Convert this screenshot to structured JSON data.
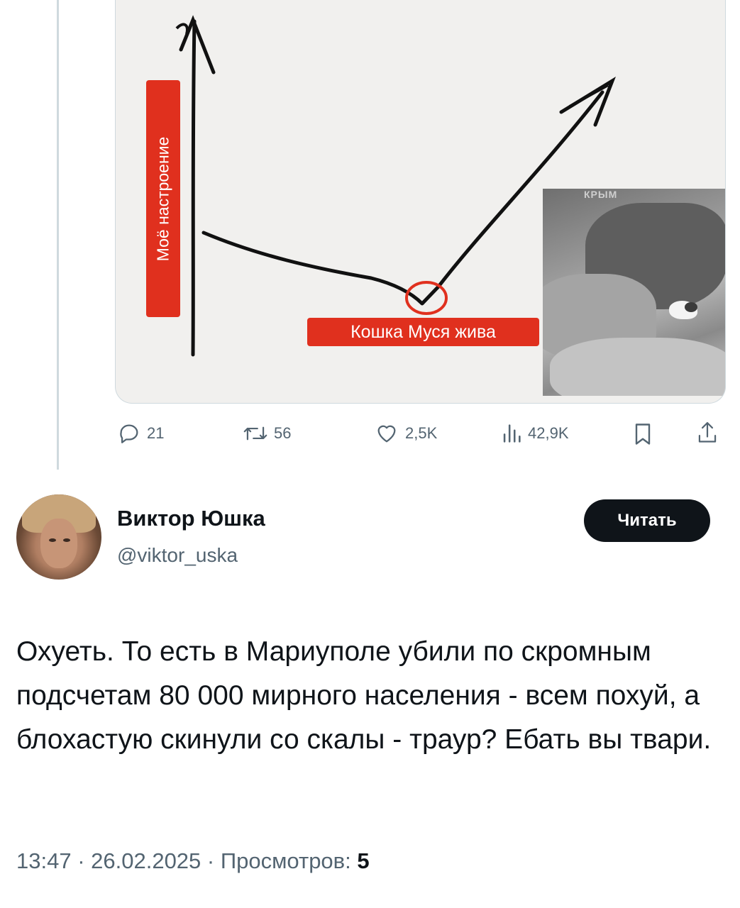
{
  "quoted_tweet": {
    "media": {
      "meme_vertical_label": "Моё настроение",
      "meme_horizontal_label": "Кошка Муся жива",
      "photo_watermark": "КРЫМ"
    },
    "actions": {
      "replies": "21",
      "reposts": "56",
      "likes": "2,5K",
      "views": "42,9K"
    }
  },
  "tweet": {
    "author_name": "Виктор Юшка",
    "author_handle": "@viktor_uska",
    "follow_label": "Читать",
    "text": "Охуеть. То есть в Мариуполе убили по скромным подсчетам 80 000 мирного населения - всем похуй, а блохастую скинули со скалы - траур? Ебать вы твари.",
    "time": "13:47",
    "date": "26.02.2025",
    "views_label": "Просмотров:",
    "views_count": "5"
  },
  "icons": [
    "reply-icon",
    "repost-icon",
    "like-icon",
    "views-icon",
    "bookmark-icon",
    "share-icon"
  ],
  "colors": {
    "label_red": "#e0301e",
    "text_secondary": "#536471",
    "button_dark": "#0f1419"
  }
}
